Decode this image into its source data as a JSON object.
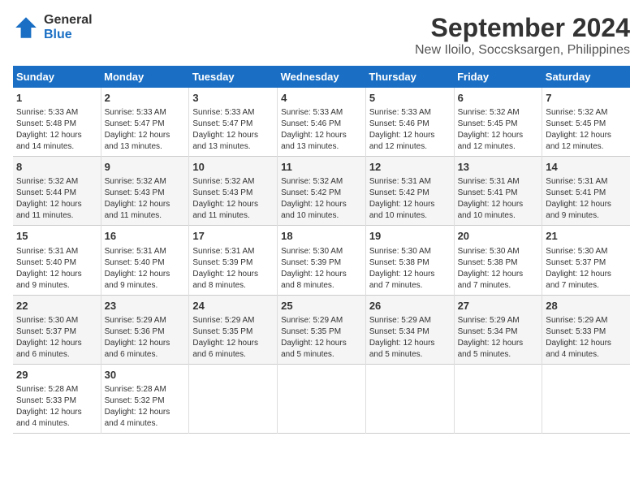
{
  "header": {
    "logo_general": "General",
    "logo_blue": "Blue",
    "title": "September 2024",
    "subtitle": "New Iloilo, Soccsksargen, Philippines"
  },
  "calendar": {
    "days_of_week": [
      "Sunday",
      "Monday",
      "Tuesday",
      "Wednesday",
      "Thursday",
      "Friday",
      "Saturday"
    ],
    "weeks": [
      [
        {
          "day": "",
          "info": ""
        },
        {
          "day": "2",
          "info": "Sunrise: 5:33 AM\nSunset: 5:47 PM\nDaylight: 12 hours\nand 13 minutes."
        },
        {
          "day": "3",
          "info": "Sunrise: 5:33 AM\nSunset: 5:47 PM\nDaylight: 12 hours\nand 13 minutes."
        },
        {
          "day": "4",
          "info": "Sunrise: 5:33 AM\nSunset: 5:46 PM\nDaylight: 12 hours\nand 13 minutes."
        },
        {
          "day": "5",
          "info": "Sunrise: 5:33 AM\nSunset: 5:46 PM\nDaylight: 12 hours\nand 12 minutes."
        },
        {
          "day": "6",
          "info": "Sunrise: 5:32 AM\nSunset: 5:45 PM\nDaylight: 12 hours\nand 12 minutes."
        },
        {
          "day": "7",
          "info": "Sunrise: 5:32 AM\nSunset: 5:45 PM\nDaylight: 12 hours\nand 12 minutes."
        }
      ],
      [
        {
          "day": "1",
          "info": "Sunrise: 5:33 AM\nSunset: 5:48 PM\nDaylight: 12 hours\nand 14 minutes."
        },
        {
          "day": "",
          "info": ""
        },
        {
          "day": "",
          "info": ""
        },
        {
          "day": "",
          "info": ""
        },
        {
          "day": "",
          "info": ""
        },
        {
          "day": "",
          "info": ""
        },
        {
          "day": "",
          "info": ""
        }
      ],
      [
        {
          "day": "8",
          "info": "Sunrise: 5:32 AM\nSunset: 5:44 PM\nDaylight: 12 hours\nand 11 minutes."
        },
        {
          "day": "9",
          "info": "Sunrise: 5:32 AM\nSunset: 5:43 PM\nDaylight: 12 hours\nand 11 minutes."
        },
        {
          "day": "10",
          "info": "Sunrise: 5:32 AM\nSunset: 5:43 PM\nDaylight: 12 hours\nand 11 minutes."
        },
        {
          "day": "11",
          "info": "Sunrise: 5:32 AM\nSunset: 5:42 PM\nDaylight: 12 hours\nand 10 minutes."
        },
        {
          "day": "12",
          "info": "Sunrise: 5:31 AM\nSunset: 5:42 PM\nDaylight: 12 hours\nand 10 minutes."
        },
        {
          "day": "13",
          "info": "Sunrise: 5:31 AM\nSunset: 5:41 PM\nDaylight: 12 hours\nand 10 minutes."
        },
        {
          "day": "14",
          "info": "Sunrise: 5:31 AM\nSunset: 5:41 PM\nDaylight: 12 hours\nand 9 minutes."
        }
      ],
      [
        {
          "day": "15",
          "info": "Sunrise: 5:31 AM\nSunset: 5:40 PM\nDaylight: 12 hours\nand 9 minutes."
        },
        {
          "day": "16",
          "info": "Sunrise: 5:31 AM\nSunset: 5:40 PM\nDaylight: 12 hours\nand 9 minutes."
        },
        {
          "day": "17",
          "info": "Sunrise: 5:31 AM\nSunset: 5:39 PM\nDaylight: 12 hours\nand 8 minutes."
        },
        {
          "day": "18",
          "info": "Sunrise: 5:30 AM\nSunset: 5:39 PM\nDaylight: 12 hours\nand 8 minutes."
        },
        {
          "day": "19",
          "info": "Sunrise: 5:30 AM\nSunset: 5:38 PM\nDaylight: 12 hours\nand 7 minutes."
        },
        {
          "day": "20",
          "info": "Sunrise: 5:30 AM\nSunset: 5:38 PM\nDaylight: 12 hours\nand 7 minutes."
        },
        {
          "day": "21",
          "info": "Sunrise: 5:30 AM\nSunset: 5:37 PM\nDaylight: 12 hours\nand 7 minutes."
        }
      ],
      [
        {
          "day": "22",
          "info": "Sunrise: 5:30 AM\nSunset: 5:37 PM\nDaylight: 12 hours\nand 6 minutes."
        },
        {
          "day": "23",
          "info": "Sunrise: 5:29 AM\nSunset: 5:36 PM\nDaylight: 12 hours\nand 6 minutes."
        },
        {
          "day": "24",
          "info": "Sunrise: 5:29 AM\nSunset: 5:35 PM\nDaylight: 12 hours\nand 6 minutes."
        },
        {
          "day": "25",
          "info": "Sunrise: 5:29 AM\nSunset: 5:35 PM\nDaylight: 12 hours\nand 5 minutes."
        },
        {
          "day": "26",
          "info": "Sunrise: 5:29 AM\nSunset: 5:34 PM\nDaylight: 12 hours\nand 5 minutes."
        },
        {
          "day": "27",
          "info": "Sunrise: 5:29 AM\nSunset: 5:34 PM\nDaylight: 12 hours\nand 5 minutes."
        },
        {
          "day": "28",
          "info": "Sunrise: 5:29 AM\nSunset: 5:33 PM\nDaylight: 12 hours\nand 4 minutes."
        }
      ],
      [
        {
          "day": "29",
          "info": "Sunrise: 5:28 AM\nSunset: 5:33 PM\nDaylight: 12 hours\nand 4 minutes."
        },
        {
          "day": "30",
          "info": "Sunrise: 5:28 AM\nSunset: 5:32 PM\nDaylight: 12 hours\nand 4 minutes."
        },
        {
          "day": "",
          "info": ""
        },
        {
          "day": "",
          "info": ""
        },
        {
          "day": "",
          "info": ""
        },
        {
          "day": "",
          "info": ""
        },
        {
          "day": "",
          "info": ""
        }
      ]
    ]
  }
}
